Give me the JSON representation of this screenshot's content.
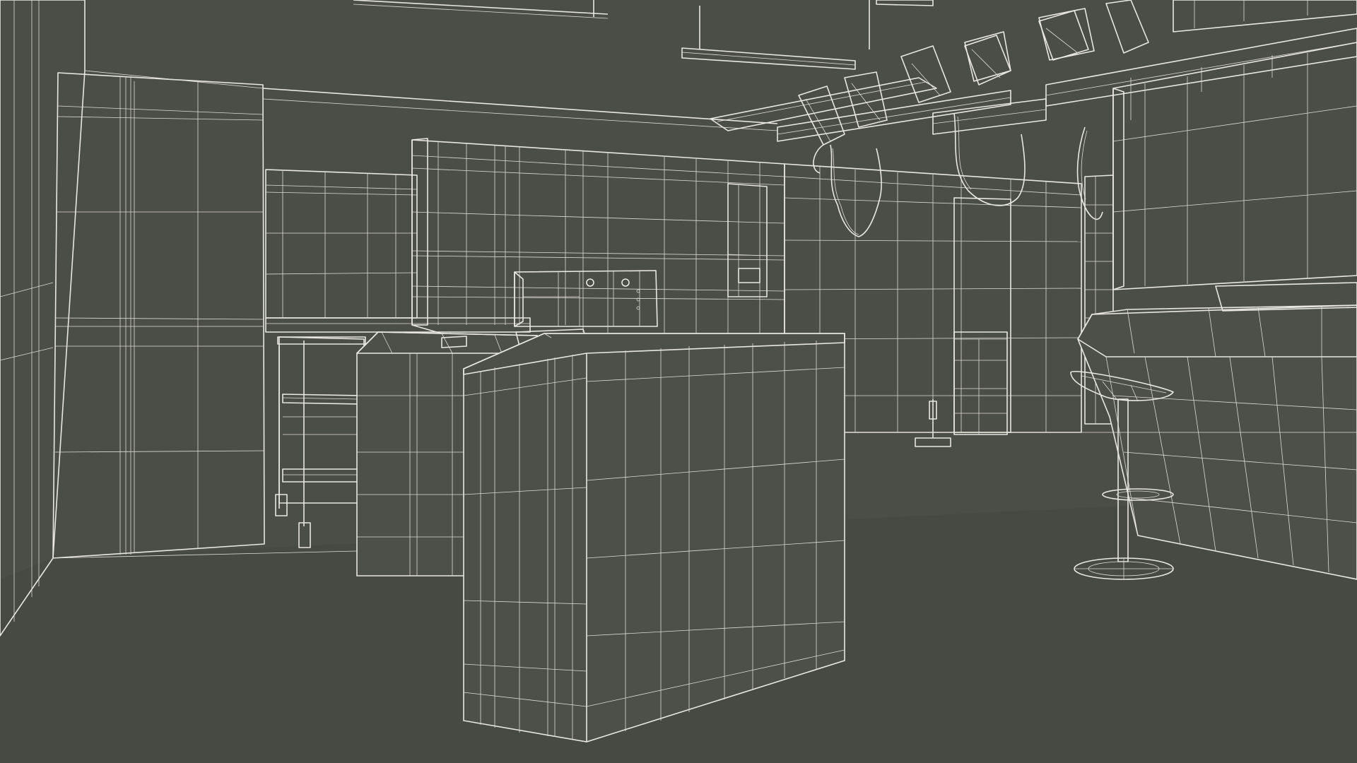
{
  "scene": {
    "subject": "operating-room",
    "render_style": "wireframe",
    "colors": {
      "background": "#4b4d47",
      "wire": "#e8e8e0"
    }
  }
}
